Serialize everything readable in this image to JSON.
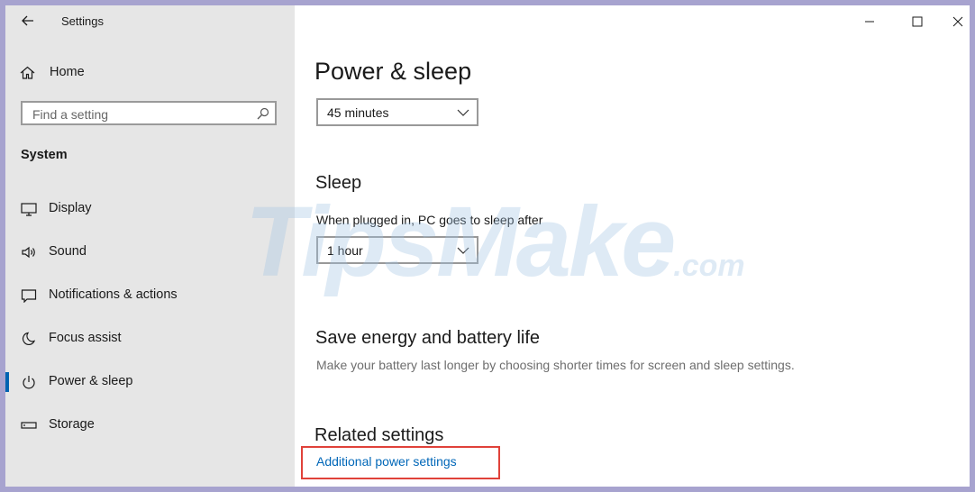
{
  "app": {
    "title": "Settings"
  },
  "sidebar": {
    "home_label": "Home",
    "search_placeholder": "Find a setting",
    "section_title": "System",
    "items": [
      {
        "label": "Display",
        "icon": "display-icon"
      },
      {
        "label": "Sound",
        "icon": "sound-icon"
      },
      {
        "label": "Notifications & actions",
        "icon": "notifications-icon"
      },
      {
        "label": "Focus assist",
        "icon": "moon-icon"
      },
      {
        "label": "Power & sleep",
        "icon": "power-icon",
        "active": true
      },
      {
        "label": "Storage",
        "icon": "storage-icon"
      }
    ]
  },
  "main": {
    "page_title": "Power & sleep",
    "screen_dropdown_value": "45 minutes",
    "sleep_heading": "Sleep",
    "sleep_label": "When plugged in, PC goes to sleep after",
    "sleep_dropdown_value": "1 hour",
    "save_heading": "Save energy and battery life",
    "save_desc": "Make your battery last longer by choosing shorter times for screen and sleep settings.",
    "related_heading": "Related settings",
    "related_link": "Additional power settings"
  },
  "watermark": {
    "main": "TipsMake",
    "suffix": ".com"
  },
  "colors": {
    "accent": "#0063b1",
    "link": "#0067b8",
    "highlight": "#e0423a",
    "frame": "#a7a3cf"
  }
}
